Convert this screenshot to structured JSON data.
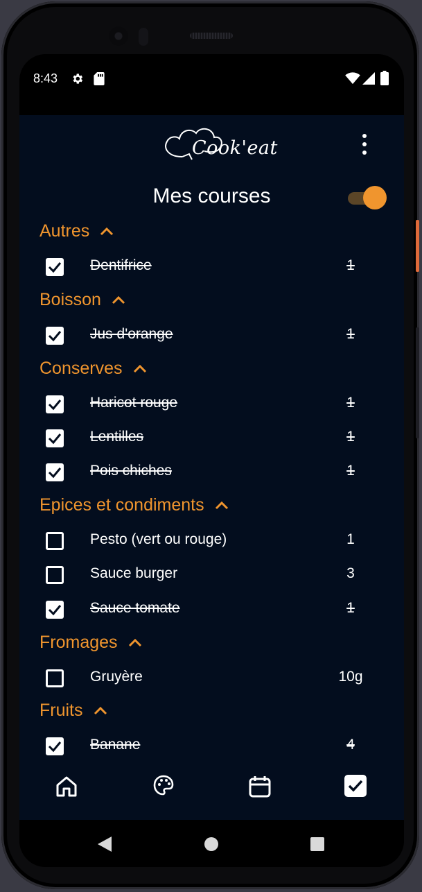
{
  "status_bar": {
    "time": "8:43",
    "icons": [
      "gear-icon",
      "sd-card-icon",
      "wifi-icon",
      "signal-icon",
      "battery-icon"
    ]
  },
  "header": {
    "logo_text": "Cook'eat",
    "title": "Mes courses",
    "menu_icon": "more-vert-icon",
    "toggle_on": true
  },
  "colors": {
    "background": "#030d1e",
    "accent": "#f0952e",
    "text": "#ffffff"
  },
  "categories": [
    {
      "name": "Autres",
      "items": [
        {
          "name": "Dentifrice",
          "qty": "1",
          "checked": true
        }
      ]
    },
    {
      "name": "Boisson",
      "items": [
        {
          "name": "Jus d'orange",
          "qty": "1",
          "checked": true
        }
      ]
    },
    {
      "name": "Conserves",
      "items": [
        {
          "name": "Haricot rouge ",
          "qty": "1",
          "checked": true
        },
        {
          "name": "Lentilles ",
          "qty": "1",
          "checked": true
        },
        {
          "name": "Pois chiches ",
          "qty": "1",
          "checked": true
        }
      ]
    },
    {
      "name": "Epices et condiments",
      "items": [
        {
          "name": "Pesto (vert ou rouge)",
          "qty": "1",
          "checked": false
        },
        {
          "name": "Sauce burger",
          "qty": "3",
          "checked": false
        },
        {
          "name": "Sauce tomate ",
          "qty": "1",
          "checked": true
        }
      ]
    },
    {
      "name": "Fromages",
      "items": [
        {
          "name": "Gruyère",
          "qty": "10g",
          "checked": false
        }
      ]
    },
    {
      "name": "Fruits",
      "items": [
        {
          "name": "Banane",
          "qty": "4",
          "checked": true
        }
      ]
    }
  ],
  "bottom_nav": [
    {
      "icon": "home-icon",
      "active": false
    },
    {
      "icon": "palette-icon",
      "active": false
    },
    {
      "icon": "calendar-icon",
      "active": false
    },
    {
      "icon": "checklist-icon",
      "active": true
    }
  ],
  "system_nav": [
    "back-icon",
    "home-circle-icon",
    "recents-icon"
  ]
}
